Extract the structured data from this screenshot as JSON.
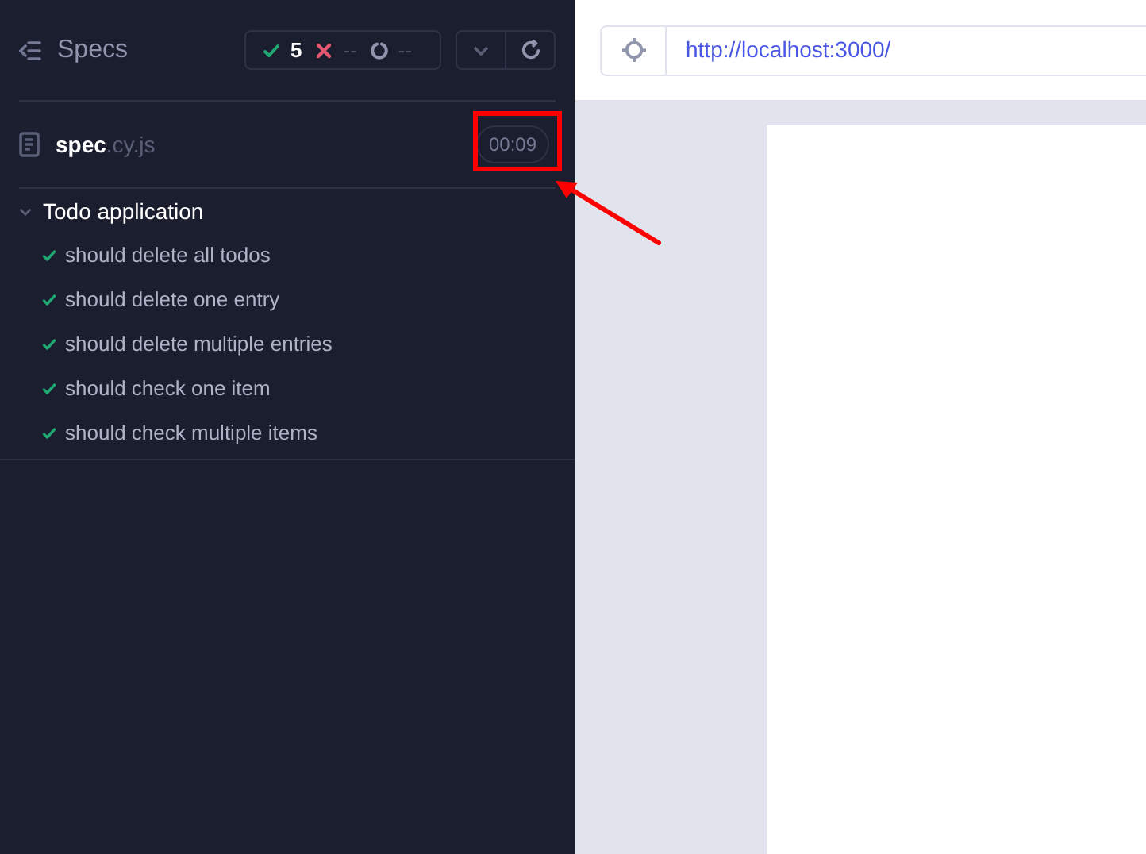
{
  "sidebar": {
    "title": "Specs",
    "stats": [
      {
        "kind": "passed",
        "count": "5"
      },
      {
        "kind": "failed",
        "count": "--"
      },
      {
        "kind": "pending",
        "count": "--"
      }
    ],
    "spec": {
      "name": "spec",
      "extension": ".cy.js",
      "duration": "00:09",
      "duration_highlighted": true
    },
    "suite": {
      "title": "Todo application",
      "expanded": true,
      "tests": [
        {
          "title": "should delete all todos",
          "passed": true
        },
        {
          "title": "should delete one entry",
          "passed": true
        },
        {
          "title": "should delete multiple entries",
          "passed": true
        },
        {
          "title": "should check one item",
          "passed": true
        },
        {
          "title": "should check multiple items",
          "passed": true
        }
      ]
    }
  },
  "browser": {
    "url": "http://localhost:3000/"
  }
}
